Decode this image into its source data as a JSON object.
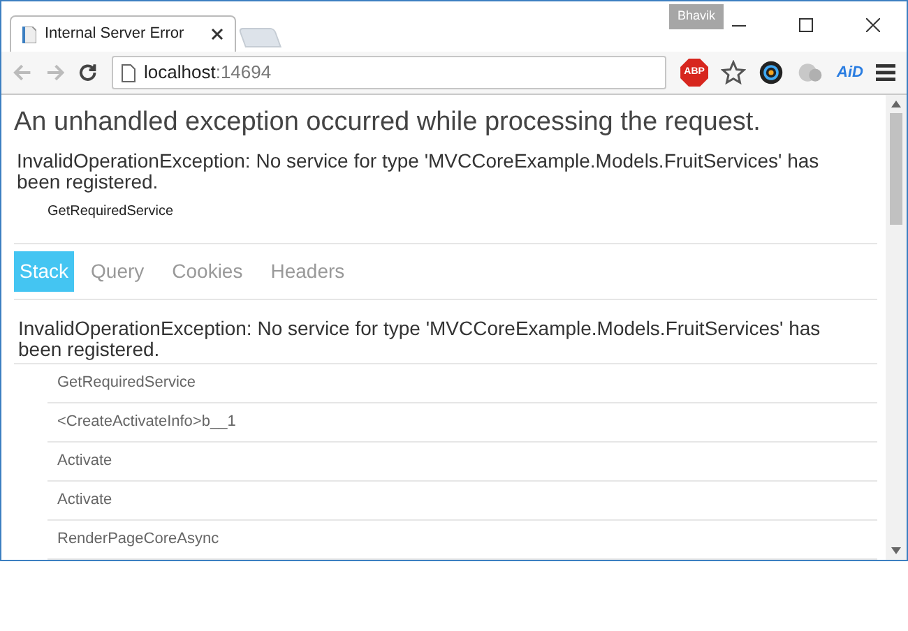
{
  "browser": {
    "user": "Bhavik",
    "tab_title": "Internal Server Error",
    "url_host": "localhost",
    "url_port": ":14694",
    "extensions": [
      {
        "kind": "abp",
        "label": "ABP"
      },
      {
        "kind": "star"
      },
      {
        "kind": "camera"
      },
      {
        "kind": "cloud"
      },
      {
        "kind": "aid",
        "label": "AiD"
      },
      {
        "kind": "menu"
      }
    ]
  },
  "page": {
    "heading": "An unhandled exception occurred while processing the request.",
    "summary": {
      "message": "InvalidOperationException: No service for type 'MVCCoreExample.Models.FruitServices' has been registered.",
      "location": "GetRequiredService"
    },
    "tabs": [
      {
        "label": "Stack",
        "selected": true
      },
      {
        "label": "Query",
        "selected": false
      },
      {
        "label": "Cookies",
        "selected": false
      },
      {
        "label": "Headers",
        "selected": false
      }
    ],
    "stack": {
      "message": "InvalidOperationException: No service for type 'MVCCoreExample.Models.FruitServices' has been registered.",
      "frames": [
        "GetRequiredService",
        "<CreateActivateInfo>b__1",
        "Activate",
        "Activate",
        "RenderPageCoreAsync"
      ]
    }
  }
}
